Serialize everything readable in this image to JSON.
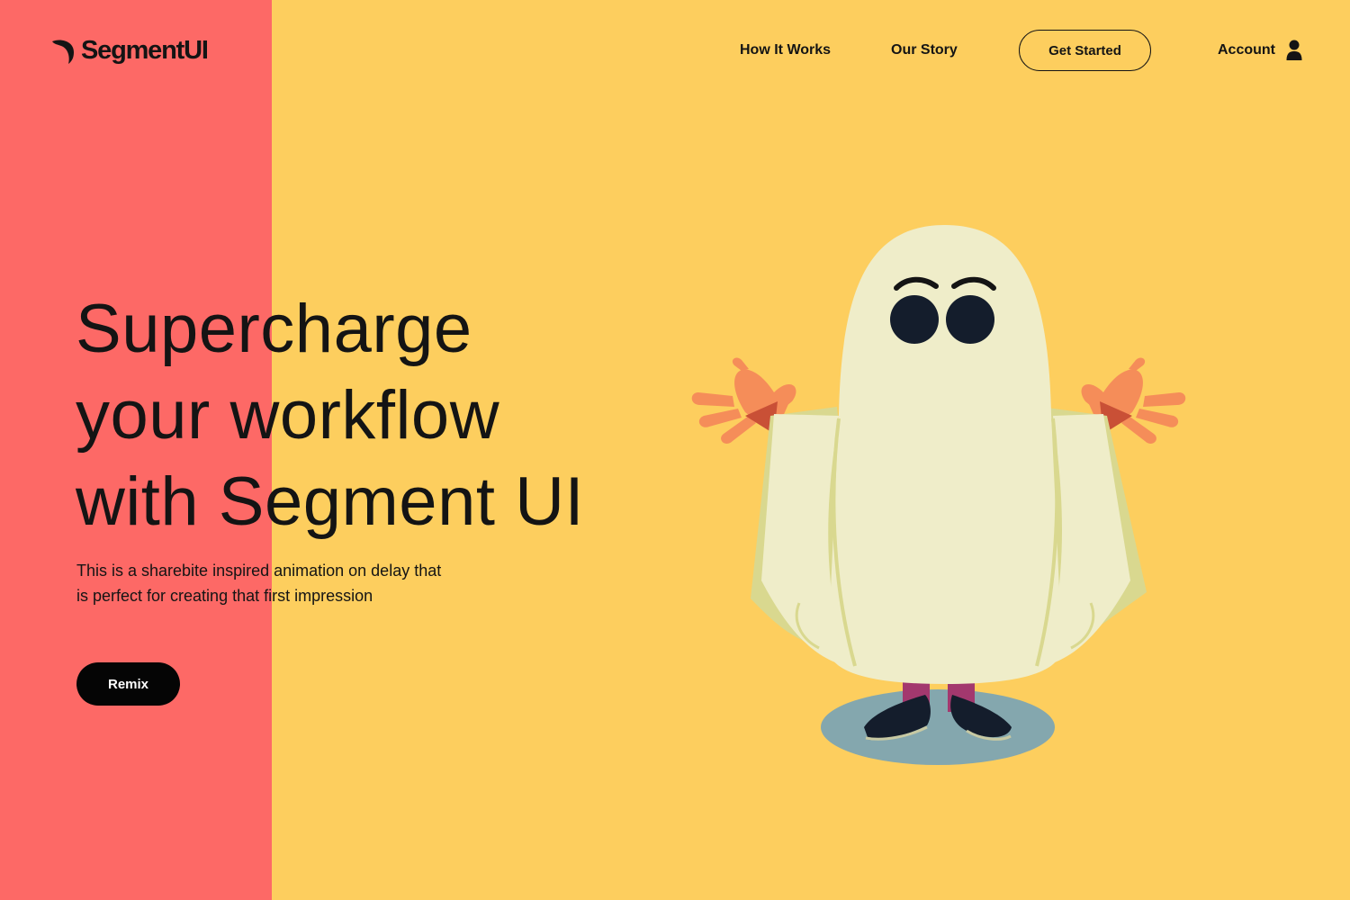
{
  "brand": {
    "name": "SegmentUI"
  },
  "nav": {
    "how_it_works": "How It Works",
    "our_story": "Our Story",
    "get_started": "Get Started",
    "account": "Account"
  },
  "hero": {
    "headline_lines": [
      "Supercharge",
      "your workflow",
      "with Segment UI"
    ],
    "subtext_lines": [
      "This is a sharebite inspired animation on delay that",
      "is perfect for creating that first impression"
    ],
    "cta": "Remix"
  },
  "illustration": {
    "subject": "ghost-character"
  },
  "colors": {
    "background": "#FDCE5E",
    "accent_band": "#FD6966",
    "text": "#141414",
    "button_dark": "#050505"
  },
  "icons": [
    "logo-mark-icon",
    "account-user-icon"
  ]
}
